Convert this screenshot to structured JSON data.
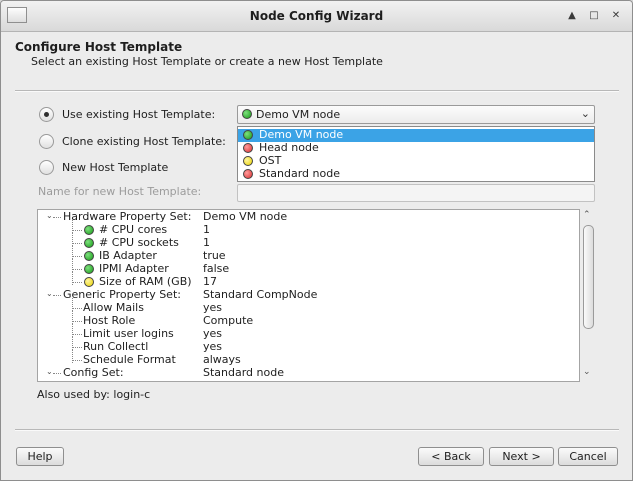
{
  "window": {
    "title": "Node Config Wizard"
  },
  "header": {
    "title": "Configure Host Template",
    "subtitle": "Select an existing Host Template or create a new Host Template"
  },
  "options": {
    "use_existing": "Use existing Host Template:",
    "clone_existing": "Clone existing Host Template:",
    "new_template": "New Host Template",
    "selected": "use_existing"
  },
  "combo": {
    "value": "Demo VM node",
    "status": "green"
  },
  "dropdown": {
    "items": [
      {
        "label": "Demo VM node",
        "status": "green",
        "selected": true
      },
      {
        "label": "Head node",
        "status": "red",
        "selected": false
      },
      {
        "label": "OST",
        "status": "yellow",
        "selected": false
      },
      {
        "label": "Standard node",
        "status": "red",
        "selected": false
      }
    ]
  },
  "name_field": {
    "label": "Name for new Host Template:",
    "value": ""
  },
  "tree": {
    "rows": [
      {
        "key": "Hardware Property Set:",
        "value": "Demo VM node",
        "level": 0
      },
      {
        "key": "# CPU cores",
        "value": "1",
        "level": 1,
        "status": "green"
      },
      {
        "key": "# CPU sockets",
        "value": "1",
        "level": 1,
        "status": "green"
      },
      {
        "key": "IB Adapter",
        "value": "true",
        "level": 1,
        "status": "green"
      },
      {
        "key": "IPMI Adapter",
        "value": "false",
        "level": 1,
        "status": "green"
      },
      {
        "key": "Size of RAM (GB)",
        "value": "17",
        "level": 1,
        "status": "yellow"
      },
      {
        "key": "Generic Property Set:",
        "value": "Standard CompNode",
        "level": 0
      },
      {
        "key": "Allow Mails",
        "value": "yes",
        "level": 1
      },
      {
        "key": "Host Role",
        "value": "Compute",
        "level": 1
      },
      {
        "key": "Limit user logins",
        "value": "yes",
        "level": 1
      },
      {
        "key": "Run Collectl",
        "value": "yes",
        "level": 1
      },
      {
        "key": "Schedule Format",
        "value": "always",
        "level": 1
      },
      {
        "key": "Config Set:",
        "value": "Standard node",
        "level": 0
      }
    ]
  },
  "also_used": "Also used by: login-c",
  "buttons": {
    "help": "Help",
    "back": "< Back",
    "next": "Next >",
    "cancel": "Cancel"
  },
  "icons": {
    "app": "window-icon",
    "shade": "chevron-up-icon",
    "maximize": "maximize-icon",
    "close": "close-icon"
  }
}
